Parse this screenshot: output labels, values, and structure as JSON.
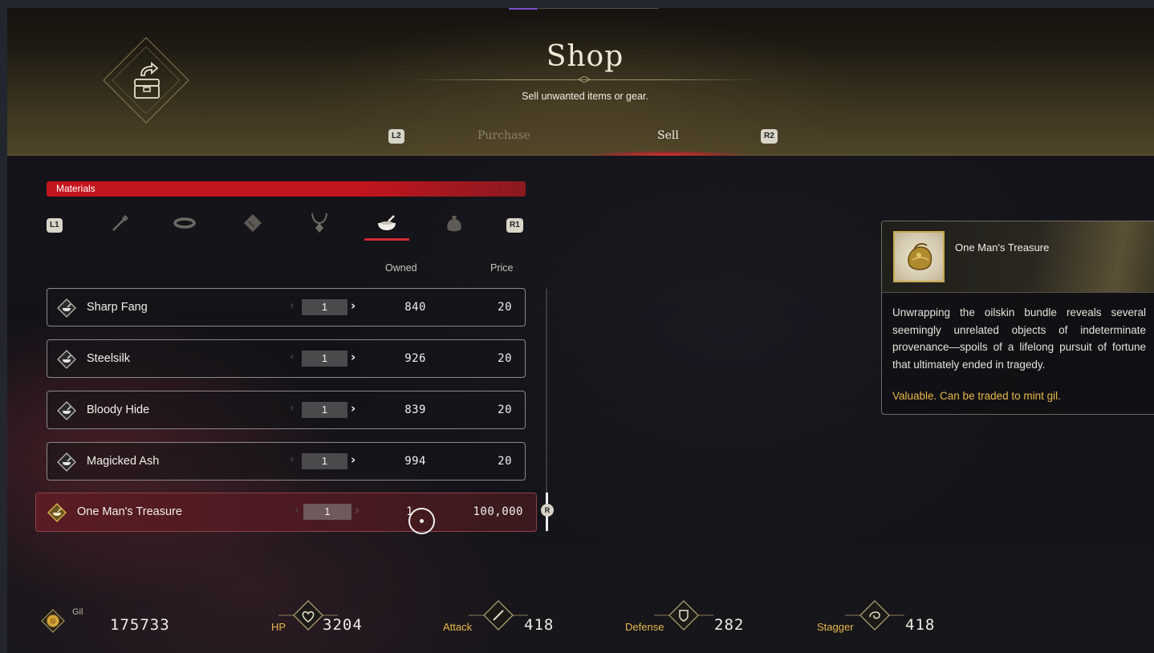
{
  "header": {
    "title": "Shop",
    "subtitle": "Sell unwanted items or gear.",
    "left_button": "L2",
    "right_button": "R2",
    "tabs": [
      {
        "label": "Purchase",
        "active": false
      },
      {
        "label": "Sell",
        "active": true
      }
    ]
  },
  "category": {
    "label": "Materials",
    "left_button": "L1",
    "right_button": "R1",
    "icons": [
      "sword-icon",
      "bracelet-icon",
      "book-icon",
      "necklace-icon",
      "bowl-icon",
      "pouch-icon"
    ],
    "active_index": 4
  },
  "columns": {
    "owned": "Owned",
    "price": "Price"
  },
  "items": [
    {
      "name": "Sharp Fang",
      "qty": "1",
      "owned": "840",
      "price": "20"
    },
    {
      "name": "Steelsilk",
      "qty": "1",
      "owned": "926",
      "price": "20"
    },
    {
      "name": "Bloody Hide",
      "qty": "1",
      "owned": "839",
      "price": "20"
    },
    {
      "name": "Magicked Ash",
      "qty": "1",
      "owned": "994",
      "price": "20"
    },
    {
      "name": "One Man's Treasure",
      "qty": "1",
      "owned": "1",
      "price": "100,000",
      "selected": true
    }
  ],
  "scroll_button": "R",
  "detail": {
    "name": "One Man's Treasure",
    "description": "Unwrapping the oilskin bundle reveals several seemingly unrelated objects of indeterminate provenance—spoils of a lifelong pursuit of fortune that ultimately ended in tragedy.",
    "note": "Valuable. Can be traded to mint gil."
  },
  "stats": {
    "gil_label": "Gil",
    "gil_value": "175733",
    "hp_label": "HP",
    "hp_value": "3204",
    "attack_label": "Attack",
    "attack_value": "418",
    "defense_label": "Defense",
    "defense_value": "282",
    "stagger_label": "Stagger",
    "stagger_value": "418"
  },
  "colors": {
    "accent_red": "#c3151e",
    "gold": "#e8b84a",
    "badge": "#d9d4c8"
  }
}
